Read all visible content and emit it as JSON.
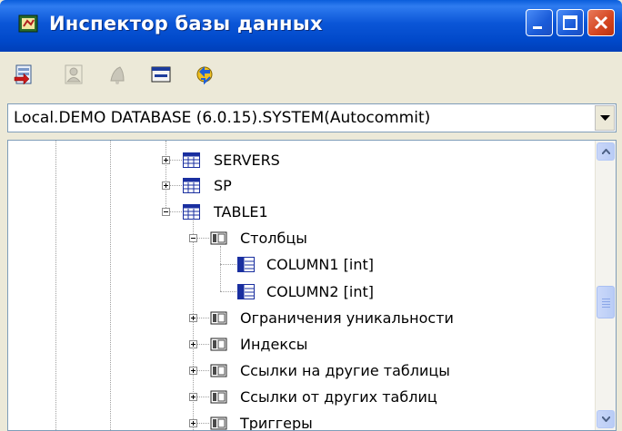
{
  "window": {
    "title": "Инспектор базы данных",
    "icon": "database-inspector-icon"
  },
  "title_buttons": {
    "minimize": "minimize-icon",
    "maximize": "maximize-icon",
    "close": "close-icon"
  },
  "toolbar": {
    "items": [
      {
        "name": "new-connection-button",
        "icon": "add-database-icon",
        "enabled": true
      },
      {
        "name": "user-button",
        "icon": "user-icon",
        "enabled": false
      },
      {
        "name": "bell-button",
        "icon": "bell-icon",
        "enabled": false
      },
      {
        "name": "window-button",
        "icon": "window-icon",
        "enabled": true
      },
      {
        "name": "refresh-button",
        "icon": "refresh-icon",
        "enabled": true
      }
    ]
  },
  "connection": {
    "value": "Local.DEMO DATABASE (6.0.15).SYSTEM(Autocommit)"
  },
  "tree": {
    "nodes": [
      {
        "label": "SERVERS",
        "icon": "table-icon",
        "level": 0,
        "expander": "plus"
      },
      {
        "label": "SP",
        "icon": "table-icon",
        "level": 0,
        "expander": "plus"
      },
      {
        "label": "TABLE1",
        "icon": "table-icon",
        "level": 0,
        "expander": "minus"
      },
      {
        "label": "Столбцы",
        "icon": "folder-icon",
        "level": 1,
        "expander": "minus"
      },
      {
        "label": "COLUMN1 [int]",
        "icon": "column-icon",
        "level": 2,
        "expander": "none"
      },
      {
        "label": "COLUMN2 [int]",
        "icon": "column-icon",
        "level": 2,
        "expander": "none"
      },
      {
        "label": "Ограничения уникальности",
        "icon": "folder-icon",
        "level": 1,
        "expander": "plus"
      },
      {
        "label": "Индексы",
        "icon": "folder-icon",
        "level": 1,
        "expander": "plus"
      },
      {
        "label": "Ссылки на другие таблицы",
        "icon": "folder-icon",
        "level": 1,
        "expander": "plus"
      },
      {
        "label": "Ссылки от других таблиц",
        "icon": "folder-icon",
        "level": 1,
        "expander": "plus"
      },
      {
        "label": "Триггеры",
        "icon": "folder-icon",
        "level": 1,
        "expander": "plus"
      }
    ]
  },
  "colors": {
    "title_bar": "#0054e3",
    "close_button": "#d4451f",
    "selection": "#316ac5"
  }
}
